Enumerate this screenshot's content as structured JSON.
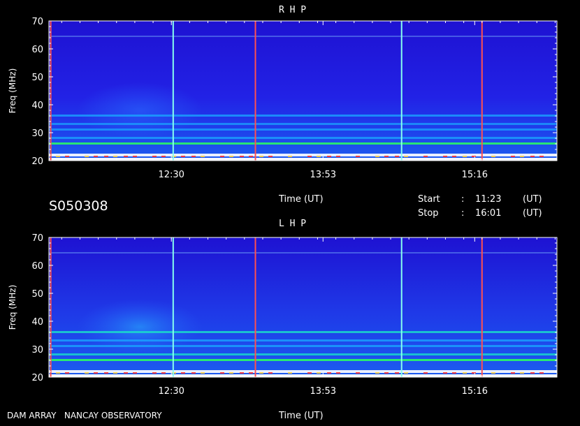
{
  "observation_id": "S050308",
  "footer_label": "DAM ARRAY   NANCAY OBSERVATORY",
  "time_info": {
    "start_label": "Start",
    "stop_label": "Stop",
    "separator": ":",
    "start_value": "11:23",
    "stop_value": "16:01",
    "unit": "(UT)"
  },
  "colors": {
    "background": "#000000",
    "axis_text": "#ffffff",
    "spectrum_low": "#1c14d8",
    "spectrum_high": "#ffffff",
    "marker_cyan": "#88ffee",
    "marker_red": "#ff5050"
  },
  "chart_data": [
    {
      "type": "heatmap",
      "title": "R H P",
      "xlabel": "Time (UT)",
      "ylabel": "Freq (MHz)",
      "xlim": [
        "11:23",
        "16:01"
      ],
      "ylim": [
        20,
        70
      ],
      "y_ticks": [
        "20",
        "30",
        "40",
        "50",
        "60",
        "70"
      ],
      "x_ticks": [
        "12:30",
        "13:53",
        "15:16"
      ],
      "vertical_markers": [
        {
          "time": "11:24",
          "color": "red"
        },
        {
          "time": "12:31",
          "color": "cyan"
        },
        {
          "time": "13:16",
          "color": "red"
        },
        {
          "time": "14:36",
          "color": "cyan"
        },
        {
          "time": "15:20",
          "color": "red"
        }
      ],
      "horizontal_markers": [
        64.5
      ],
      "emission_bands_mhz": [
        {
          "freq": 20.5,
          "intensity": 1.0
        },
        {
          "freq": 22,
          "intensity": 0.9
        },
        {
          "freq": 26,
          "intensity": 0.75
        },
        {
          "freq": 28,
          "intensity": 0.45
        },
        {
          "freq": 31,
          "intensity": 0.4
        },
        {
          "freq": 33,
          "intensity": 0.35
        },
        {
          "freq": 36,
          "intensity": 0.5
        }
      ]
    },
    {
      "type": "heatmap",
      "title": "L H P",
      "xlabel": "Time (UT)",
      "ylabel": "Freq (MHz)",
      "xlim": [
        "11:23",
        "16:01"
      ],
      "ylim": [
        20,
        70
      ],
      "y_ticks": [
        "20",
        "30",
        "40",
        "50",
        "60",
        "70"
      ],
      "x_ticks": [
        "12:30",
        "13:53",
        "15:16"
      ],
      "vertical_markers": [
        {
          "time": "11:24",
          "color": "red"
        },
        {
          "time": "12:31",
          "color": "cyan"
        },
        {
          "time": "13:16",
          "color": "red"
        },
        {
          "time": "14:36",
          "color": "cyan"
        },
        {
          "time": "15:20",
          "color": "red"
        }
      ],
      "horizontal_markers": [
        64.5
      ],
      "emission_bands_mhz": [
        {
          "freq": 20.5,
          "intensity": 1.0
        },
        {
          "freq": 22,
          "intensity": 0.9
        },
        {
          "freq": 26,
          "intensity": 0.8
        },
        {
          "freq": 28,
          "intensity": 0.55
        },
        {
          "freq": 31,
          "intensity": 0.5
        },
        {
          "freq": 33,
          "intensity": 0.5
        },
        {
          "freq": 36,
          "intensity": 0.6
        }
      ]
    }
  ]
}
